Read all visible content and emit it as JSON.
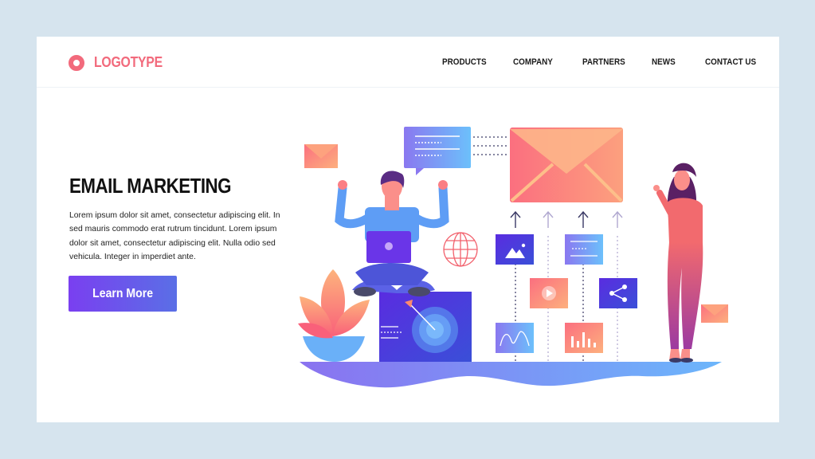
{
  "header": {
    "logo_text": "LOGOTYPE",
    "nav": [
      {
        "label": "PRODUCTS"
      },
      {
        "label": "COMPANY"
      },
      {
        "label": "PARTNERS"
      },
      {
        "label": "NEWS"
      },
      {
        "label": "CONTACT US"
      }
    ]
  },
  "hero": {
    "title": "EMAIL MARKETING",
    "body": "Lorem ipsum dolor sit amet, consectetur adipiscing elit. In sed mauris commodo erat rutrum tincidunt. Lorem ipsum dolor sit amet, consectetur adipiscing elit. Nulla  odio sed vehicula. Integer in imperdiet ante.",
    "cta_label": "Learn More"
  },
  "illustration": {
    "elements": [
      "envelope-icon",
      "chat-bubble-icon",
      "man-with-laptop",
      "globe-icon",
      "image-icon",
      "text-lines-icon",
      "video-play-icon",
      "share-icon",
      "wave-chart-icon",
      "bar-chart-icon",
      "target-icon",
      "lotus-plant",
      "woman-pointing"
    ]
  },
  "colors": {
    "background": "#d6e4ee",
    "accent_coral": "#f26a7c",
    "accent_purple": "#6a3de8",
    "accent_blue": "#5aa0f5"
  }
}
